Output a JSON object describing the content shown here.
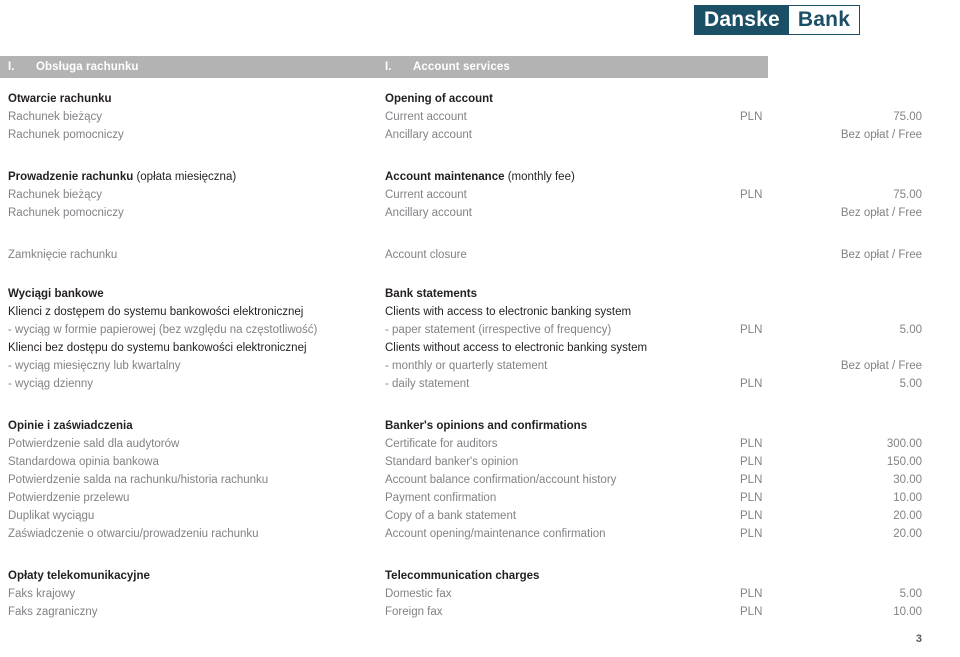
{
  "brand": {
    "logo_left": "Danske",
    "logo_right": "Bank"
  },
  "section": {
    "number_pl": "I.",
    "title_pl": "Obsługa rachunku",
    "number_en": "I.",
    "title_en": "Account services"
  },
  "groups": [
    {
      "header": {
        "pl": "Otwarcie rachunku",
        "pl_sub": "",
        "en": "Opening of account",
        "en_sub": ""
      },
      "rows": [
        {
          "pl": "Rachunek bieżący",
          "en": "Current account",
          "currency": "PLN",
          "amount": "75.00",
          "free": ""
        },
        {
          "pl": "Rachunek pomocniczy",
          "en": "Ancillary account",
          "currency": "",
          "amount": "",
          "free": "Bez opłat / Free"
        }
      ]
    },
    {
      "header": {
        "pl": "Prowadzenie rachunku",
        "pl_sub": " (opłata miesięczna)",
        "en": "Account maintenance",
        "en_sub": " (monthly fee)"
      },
      "rows": [
        {
          "pl": "Rachunek bieżący",
          "en": "Current account",
          "currency": "PLN",
          "amount": "75.00",
          "free": ""
        },
        {
          "pl": "Rachunek pomocniczy",
          "en": "Ancillary account",
          "currency": "",
          "amount": "",
          "free": "Bez opłat / Free"
        }
      ]
    },
    {
      "header": null,
      "rows": [
        {
          "pl": "Zamknięcie  rachunku",
          "en": "Account closure",
          "currency": "",
          "amount": "",
          "free": "Bez opłat / Free"
        }
      ]
    },
    {
      "header": {
        "pl": "Wyciągi bankowe",
        "pl_sub": "",
        "en": "Bank statements",
        "en_sub": ""
      },
      "rows": [
        {
          "pl": "Klienci z dostępem do systemu bankowości elektronicznej",
          "en": "Clients with access to electronic banking system",
          "currency": "",
          "amount": "",
          "free": "",
          "dark": true
        },
        {
          "pl": "- wyciąg w formie papierowej (bez względu na częstotliwość)",
          "en": "- paper statement (irrespective of frequency)",
          "currency": "PLN",
          "amount": "5.00",
          "free": ""
        },
        {
          "pl": "Klienci bez dostępu do systemu bankowości elektronicznej",
          "en": "Clients without access to electronic banking system",
          "currency": "",
          "amount": "",
          "free": "",
          "dark": true
        },
        {
          "pl": "- wyciąg miesięczny lub kwartalny",
          "en": "- monthly or quarterly statement",
          "currency": "",
          "amount": "",
          "free": "Bez opłat / Free"
        },
        {
          "pl": "- wyciąg dzienny",
          "en": "- daily statement",
          "currency": "PLN",
          "amount": "5.00",
          "free": ""
        }
      ]
    },
    {
      "header": {
        "pl": "Opinie i zaświadczenia",
        "pl_sub": "",
        "en": "Banker's opinions and confirmations",
        "en_sub": ""
      },
      "rows": [
        {
          "pl": "Potwierdzenie sald dla audytorów",
          "en": "Certificate for auditors",
          "currency": "PLN",
          "amount": "300.00",
          "free": ""
        },
        {
          "pl": "Standardowa opinia bankowa",
          "en": "Standard banker's opinion",
          "currency": "PLN",
          "amount": "150.00",
          "free": ""
        },
        {
          "pl": "Potwierdzenie salda na rachunku/historia rachunku",
          "en": "Account balance confirmation/account history",
          "currency": "PLN",
          "amount": "30.00",
          "free": ""
        },
        {
          "pl": "Potwierdzenie przelewu",
          "en": "Payment confirmation",
          "currency": "PLN",
          "amount": "10.00",
          "free": ""
        },
        {
          "pl": "Duplikat wyciągu",
          "en": "Copy of a bank statement",
          "currency": "PLN",
          "amount": "20.00",
          "free": ""
        },
        {
          "pl": "Zaświadczenie o otwarciu/prowadzeniu rachunku",
          "en": "Account opening/maintenance confirmation",
          "currency": "PLN",
          "amount": "20.00",
          "free": ""
        }
      ]
    },
    {
      "header": {
        "pl": "Opłaty telekomunikacyjne",
        "pl_sub": "",
        "en": "Telecommunication charges",
        "en_sub": ""
      },
      "rows": [
        {
          "pl": "Faks krajowy",
          "en": "Domestic fax",
          "currency": "PLN",
          "amount": "5.00",
          "free": ""
        },
        {
          "pl": "Faks zagraniczny",
          "en": "Foreign fax",
          "currency": "PLN",
          "amount": "10.00",
          "free": ""
        }
      ]
    }
  ],
  "footer": {
    "page_number": "3"
  },
  "colors": {
    "brand_teal": "#1a4f66",
    "bar_gray": "#b3b3b3",
    "body_gray": "#808285",
    "heading_dark": "#231f20"
  }
}
